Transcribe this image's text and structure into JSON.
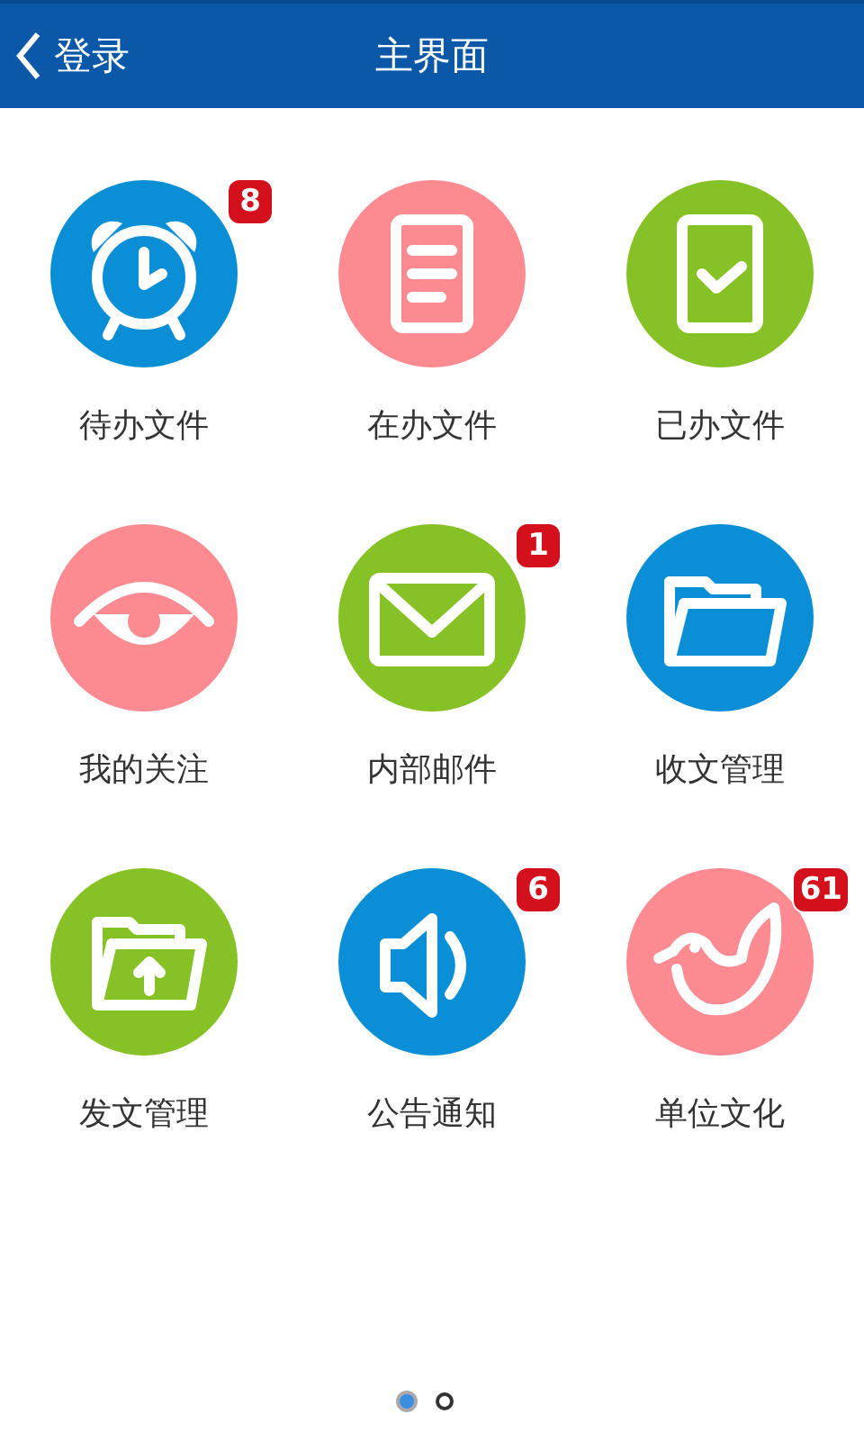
{
  "header": {
    "back": {
      "label": "登录"
    },
    "title": "主界面"
  },
  "modules": [
    {
      "label": "待办文件",
      "color": "#0a8fd6",
      "badge": "8"
    },
    {
      "label": "在办文件",
      "color": "#fe8b92"
    },
    {
      "label": "已办文件",
      "color": "#86c226"
    },
    {
      "label": "我的关注",
      "color": "#fe8b92"
    },
    {
      "label": "内部邮件",
      "color": "#86c226",
      "badge": "1"
    },
    {
      "label": "收文管理",
      "color": "#0a8fd6"
    },
    {
      "label": "发文管理",
      "color": "#86c226"
    },
    {
      "label": "公告通知",
      "color": "#0a8fd6",
      "badge": "6"
    },
    {
      "label": "单位文化",
      "color": "#fe8b92",
      "badge": "61"
    }
  ],
  "pages": [
    {
      "selected": true
    },
    {
      "selected": false
    }
  ]
}
